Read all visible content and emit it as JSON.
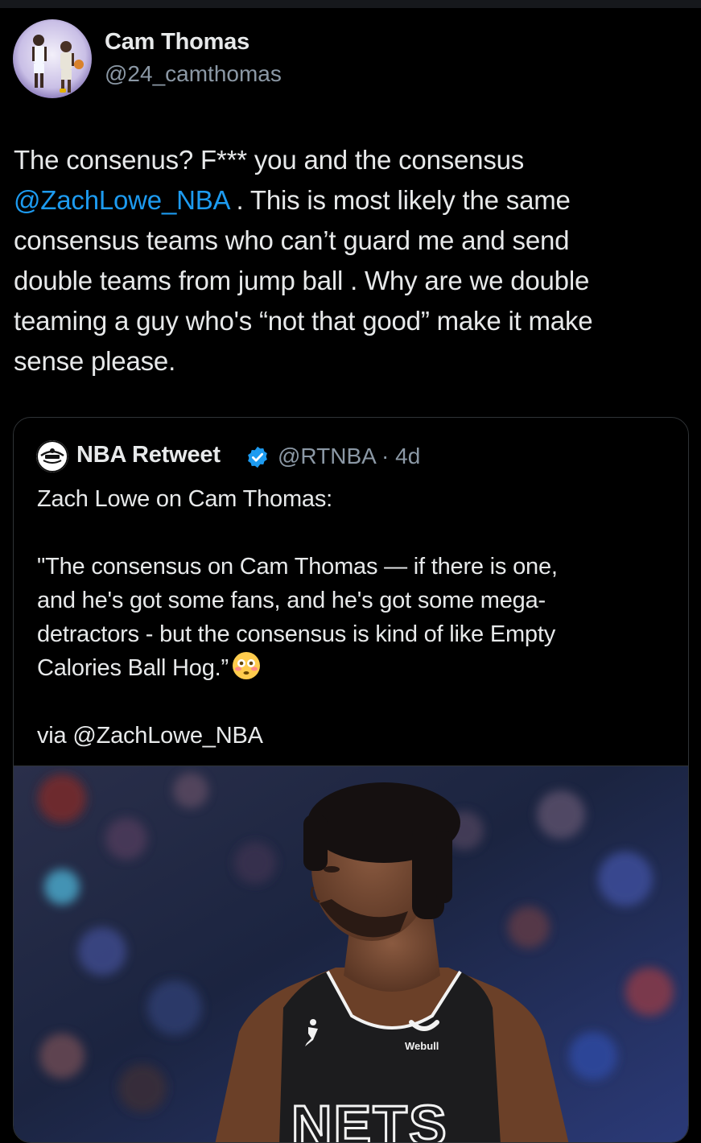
{
  "tweet": {
    "author_name": "Cam Thomas",
    "author_handle": "@24_camthomas",
    "text_lines": [
      {
        "pre": "The consenus? F*** you and the consensus",
        "mention": "",
        "post": ""
      },
      {
        "pre": "",
        "mention": "@ZachLowe_NBA",
        "post": " . This is most likely the same"
      },
      {
        "pre": "consensus teams who can’t guard me and send",
        "mention": "",
        "post": ""
      },
      {
        "pre": "double teams from jump ball . Why are we double",
        "mention": "",
        "post": ""
      },
      {
        "pre": "teaming a guy who's “not that good” make it make",
        "mention": "",
        "post": ""
      },
      {
        "pre": "sense please.",
        "mention": "",
        "post": ""
      }
    ]
  },
  "quote": {
    "author_name": "NBA Retweet",
    "verified_icon": "verified-badge-icon",
    "handle_time": "@RTNBA · 4d",
    "intro": "Zach Lowe on Cam Thomas:",
    "quote_lines": [
      "\"The consensus on Cam Thomas — if there is one,",
      "and he's got some fans, and he's got some mega-",
      "detractors - but the consensus is kind of like Empty",
      "Calories Ball Hog.”"
    ],
    "emoji": "flushed-face-emoji",
    "via": "via @ZachLowe_NBA",
    "media": {
      "jersey_text": "NETS",
      "sponsor_text": "Webull"
    }
  },
  "colors": {
    "background": "#000000",
    "text": "#e7e9ea",
    "secondary": "#8b98a5",
    "link": "#1d9bf0",
    "border": "#2f3336"
  }
}
